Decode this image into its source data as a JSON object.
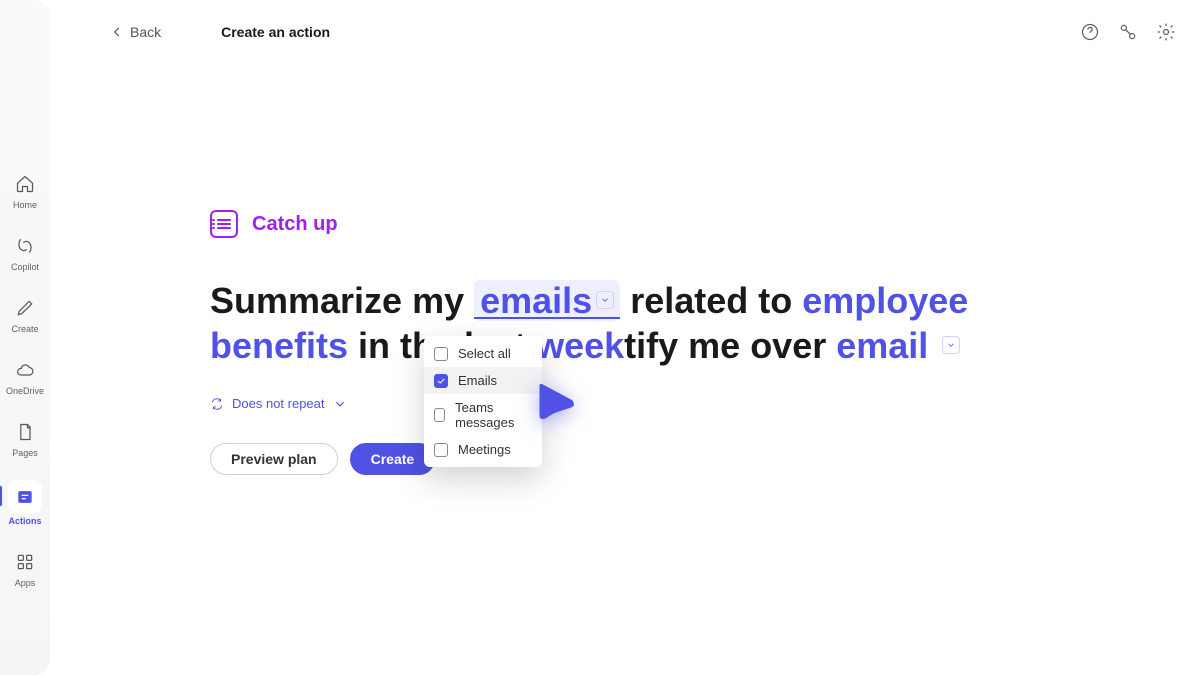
{
  "rail": {
    "home": "Home",
    "copilot": "Copilot",
    "create": "Create",
    "onedrive": "OneDrive",
    "pages": "Pages",
    "actions": "Actions",
    "apps": "Apps"
  },
  "topbar": {
    "back": "Back",
    "title": "Create an action"
  },
  "chip": {
    "label": "Catch up"
  },
  "sentence": {
    "s1": "Summarize my ",
    "source": "emails",
    "s2": " related to ",
    "topic": "employee benefits",
    "s3": " in the last ",
    "period": "week",
    "s4": "tify me over ",
    "channel": "email"
  },
  "repeat": {
    "label": "Does not repeat"
  },
  "buttons": {
    "preview": "Preview plan",
    "create": "Create"
  },
  "dropdown": {
    "selectAll": "Select all",
    "emails": "Emails",
    "teams": "Teams messages",
    "meetings": "Meetings"
  }
}
